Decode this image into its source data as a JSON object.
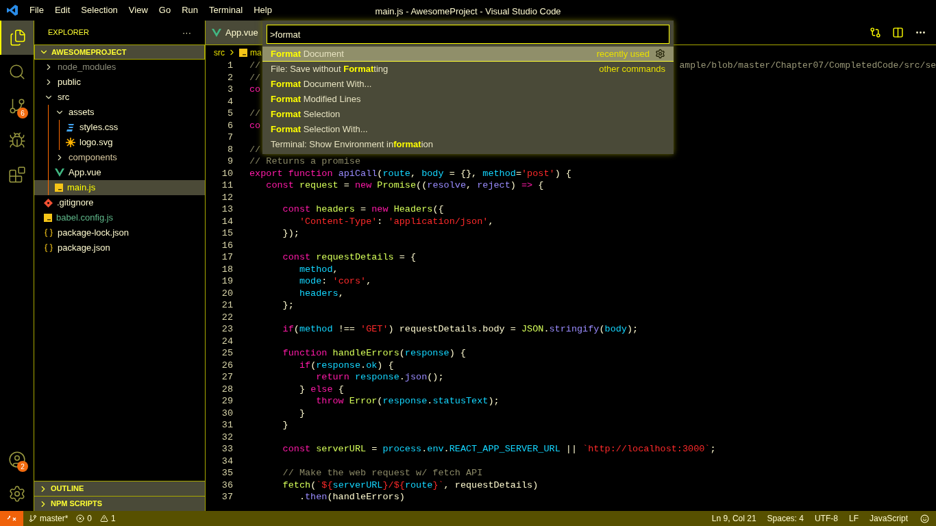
{
  "window": {
    "title": "main.js - AwesomeProject - Visual Studio Code"
  },
  "menu": [
    "File",
    "Edit",
    "Selection",
    "View",
    "Go",
    "Run",
    "Terminal",
    "Help"
  ],
  "activity_bar": [
    {
      "kind": "files",
      "selected": true
    },
    {
      "kind": "search",
      "selected": false
    },
    {
      "kind": "source-control",
      "selected": false,
      "badge": "6"
    },
    {
      "kind": "debug",
      "selected": false
    },
    {
      "kind": "extensions",
      "selected": false
    }
  ],
  "activity_bar_bottom": [
    {
      "kind": "account",
      "badge": "2"
    },
    {
      "kind": "settings"
    }
  ],
  "sidebar": {
    "title": "EXPLORER",
    "more": "···",
    "root": {
      "label": "AWESOMEPROJECT",
      "expanded": true,
      "children": [
        {
          "label": "node_modules",
          "kind": "folder",
          "expanded": false,
          "selected": false,
          "color": "#8c8c7a"
        },
        {
          "label": "public",
          "kind": "folder",
          "expanded": false,
          "selected": false,
          "color": "#fffbd0"
        },
        {
          "label": "src",
          "kind": "folder",
          "expanded": true,
          "selected": false,
          "color": "#fffbd0",
          "children": [
            {
              "label": "assets",
              "kind": "folder",
              "expanded": true,
              "selected": false,
              "color": "#fffbd0",
              "children": [
                {
                  "label": "styles.css",
                  "kind": "css",
                  "selected": false,
                  "color": "#fffbd0"
                },
                {
                  "label": "logo.svg",
                  "kind": "svg",
                  "selected": false,
                  "color": "#fffbd0"
                }
              ]
            },
            {
              "label": "components",
              "kind": "folder",
              "expanded": false,
              "selected": false,
              "color": "#d9c9a0"
            },
            {
              "label": "App.vue",
              "kind": "vue",
              "selected": false,
              "color": "#fffbd0"
            },
            {
              "label": "main.js",
              "kind": "js",
              "selected": true
            }
          ]
        },
        {
          "label": ".gitignore",
          "kind": "git",
          "selected": false,
          "color": "#fffbd0"
        },
        {
          "label": "babel.config.js",
          "kind": "js",
          "selected": false,
          "color": "#5fb88a"
        },
        {
          "label": "package-lock.json",
          "kind": "json",
          "selected": false,
          "color": "#fffbd0"
        },
        {
          "label": "package.json",
          "kind": "json",
          "selected": false,
          "color": "#fffbd0"
        }
      ]
    },
    "sections": [
      {
        "label": "OUTLINE",
        "expanded": false
      },
      {
        "label": "NPM SCRIPTS",
        "expanded": false
      }
    ]
  },
  "tabs": [
    {
      "label": "App.vue",
      "kind": "vue",
      "selected": false
    }
  ],
  "breadcrumb": [
    {
      "label": "src",
      "kind": "folder"
    },
    {
      "label": "ma",
      "kind": "js"
    }
  ],
  "command_palette": {
    "value": ">format",
    "items": [
      {
        "label": "**Format** Document",
        "detail": "recently used",
        "selected": true
      },
      {
        "label": "File: Save without **Format**ting",
        "detail": "other commands",
        "selected": false
      },
      {
        "label": "**Format** Document With...",
        "selected": false
      },
      {
        "label": "**Format** Modified Lines",
        "selected": false
      },
      {
        "label": "**Format** Selection",
        "selected": false
      },
      {
        "label": "**Format** Selection With...",
        "selected": false
      },
      {
        "label": "Terminal: Show Environment in**format**ion",
        "selected": false
      }
    ]
  },
  "editor": {
    "lines": [
      {
        "number": "1",
        "tokens": [
          {
            "text": "//",
            "kind": "cmt"
          }
        ],
        "tail": "ample/blob/master/Chapter07/CompletedCode/src/se"
      },
      {
        "number": "2",
        "tokens": [
          {
            "text": "//",
            "kind": "cmt"
          }
        ]
      },
      {
        "number": "3",
        "tokens": [
          {
            "text": "co",
            "kind": "kw"
          }
        ]
      },
      {
        "number": "4"
      },
      {
        "number": "5",
        "tokens": [
          {
            "text": "//",
            "kind": "cmt"
          }
        ]
      },
      {
        "number": "6",
        "tokens": [
          {
            "text": "co",
            "kind": "kw"
          }
        ]
      },
      {
        "number": "7"
      },
      {
        "number": "8",
        "tokens": [
          {
            "text": "//",
            "kind": "cmt"
          }
        ]
      },
      {
        "number": "9",
        "tokens": [
          {
            "text": "// Returns a promise",
            "kind": "cmt"
          }
        ]
      },
      {
        "number": "10",
        "tokens": [
          {
            "text": "export function ",
            "kind": "kw"
          },
          {
            "text": "apiCall",
            "kind": "fn"
          },
          {
            "text": "(",
            "kind": "p"
          },
          {
            "text": "route",
            "kind": "var"
          },
          {
            "text": ", ",
            "kind": "p"
          },
          {
            "text": "body",
            "kind": "var"
          },
          {
            "text": " = {}, ",
            "kind": "p"
          },
          {
            "text": "method",
            "kind": "var"
          },
          {
            "text": "=",
            "kind": "p"
          },
          {
            "text": "'post'",
            "kind": "str"
          },
          {
            "text": ") {",
            "kind": "p"
          }
        ]
      },
      {
        "number": "11",
        "tokens": [
          {
            "text": "   const ",
            "kind": "kw"
          },
          {
            "text": "request",
            "kind": "cls"
          },
          {
            "text": " = ",
            "kind": "p"
          },
          {
            "text": "new ",
            "kind": "kw"
          },
          {
            "text": "Promise",
            "kind": "cls"
          },
          {
            "text": "((",
            "kind": "p"
          },
          {
            "text": "resolve",
            "kind": "fn"
          },
          {
            "text": ", ",
            "kind": "p"
          },
          {
            "text": "reject",
            "kind": "fn"
          },
          {
            "text": ") ",
            "kind": "p"
          },
          {
            "text": "=>",
            "kind": "kw"
          },
          {
            "text": " {",
            "kind": "p"
          }
        ]
      },
      {
        "number": "12"
      },
      {
        "number": "13",
        "tokens": [
          {
            "text": "      const ",
            "kind": "kw"
          },
          {
            "text": "headers",
            "kind": "cls"
          },
          {
            "text": " = ",
            "kind": "p"
          },
          {
            "text": "new ",
            "kind": "kw"
          },
          {
            "text": "Headers",
            "kind": "cls"
          },
          {
            "text": "({",
            "kind": "p"
          }
        ]
      },
      {
        "number": "14",
        "tokens": [
          {
            "text": "         'Content-Type'",
            "kind": "str"
          },
          {
            "text": ": ",
            "kind": "p"
          },
          {
            "text": "'application/json'",
            "kind": "str"
          },
          {
            "text": ",",
            "kind": "p"
          }
        ]
      },
      {
        "number": "15",
        "tokens": [
          {
            "text": "      });",
            "kind": "p"
          }
        ]
      },
      {
        "number": "16"
      },
      {
        "number": "17",
        "tokens": [
          {
            "text": "      const ",
            "kind": "kw"
          },
          {
            "text": "requestDetails",
            "kind": "cls"
          },
          {
            "text": " = {",
            "kind": "p"
          }
        ]
      },
      {
        "number": "18",
        "tokens": [
          {
            "text": "         method",
            "kind": "var"
          },
          {
            "text": ",",
            "kind": "p"
          }
        ]
      },
      {
        "number": "19",
        "tokens": [
          {
            "text": "         mode",
            "kind": "var"
          },
          {
            "text": ": ",
            "kind": "p"
          },
          {
            "text": "'cors'",
            "kind": "str"
          },
          {
            "text": ",",
            "kind": "p"
          }
        ]
      },
      {
        "number": "20",
        "tokens": [
          {
            "text": "         headers",
            "kind": "var"
          },
          {
            "text": ",",
            "kind": "p"
          }
        ]
      },
      {
        "number": "21",
        "tokens": [
          {
            "text": "      };",
            "kind": "p"
          }
        ]
      },
      {
        "number": "22"
      },
      {
        "number": "23",
        "tokens": [
          {
            "text": "      if",
            "kind": "kw"
          },
          {
            "text": "(",
            "kind": "p"
          },
          {
            "text": "method",
            "kind": "var"
          },
          {
            "text": " !== ",
            "kind": "p"
          },
          {
            "text": "'GET'",
            "kind": "str"
          },
          {
            "text": ") requestDetails.body = ",
            "kind": "p"
          },
          {
            "text": "JSON",
            "kind": "cls"
          },
          {
            "text": ".",
            "kind": "p"
          },
          {
            "text": "stringify",
            "kind": "fn"
          },
          {
            "text": "(",
            "kind": "p"
          },
          {
            "text": "body",
            "kind": "var"
          },
          {
            "text": ");",
            "kind": "p"
          }
        ]
      },
      {
        "number": "24"
      },
      {
        "number": "25",
        "tokens": [
          {
            "text": "      function ",
            "kind": "kw"
          },
          {
            "text": "handleErrors",
            "kind": "cls"
          },
          {
            "text": "(",
            "kind": "p"
          },
          {
            "text": "response",
            "kind": "var"
          },
          {
            "text": ") {",
            "kind": "p"
          }
        ]
      },
      {
        "number": "26",
        "tokens": [
          {
            "text": "         if",
            "kind": "kw"
          },
          {
            "text": "(",
            "kind": "p"
          },
          {
            "text": "response",
            "kind": "var"
          },
          {
            "text": ".",
            "kind": "p"
          },
          {
            "text": "ok",
            "kind": "var"
          },
          {
            "text": ") {",
            "kind": "p"
          }
        ]
      },
      {
        "number": "27",
        "tokens": [
          {
            "text": "            return ",
            "kind": "kw"
          },
          {
            "text": "response",
            "kind": "var"
          },
          {
            "text": ".",
            "kind": "p"
          },
          {
            "text": "json",
            "kind": "fn"
          },
          {
            "text": "();",
            "kind": "p"
          }
        ]
      },
      {
        "number": "28",
        "tokens": [
          {
            "text": "         } ",
            "kind": "p"
          },
          {
            "text": "else",
            "kind": "kw"
          },
          {
            "text": " {",
            "kind": "p"
          }
        ]
      },
      {
        "number": "29",
        "tokens": [
          {
            "text": "            throw ",
            "kind": "kw"
          },
          {
            "text": "Error",
            "kind": "cls"
          },
          {
            "text": "(",
            "kind": "p"
          },
          {
            "text": "response",
            "kind": "var"
          },
          {
            "text": ".",
            "kind": "p"
          },
          {
            "text": "statusText",
            "kind": "var"
          },
          {
            "text": ");",
            "kind": "p"
          }
        ]
      },
      {
        "number": "30",
        "tokens": [
          {
            "text": "         }",
            "kind": "p"
          }
        ]
      },
      {
        "number": "31",
        "tokens": [
          {
            "text": "      }",
            "kind": "p"
          }
        ]
      },
      {
        "number": "32"
      },
      {
        "number": "33",
        "tokens": [
          {
            "text": "      const ",
            "kind": "kw"
          },
          {
            "text": "serverURL",
            "kind": "cls"
          },
          {
            "text": " = ",
            "kind": "p"
          },
          {
            "text": "process",
            "kind": "var"
          },
          {
            "text": ".",
            "kind": "p"
          },
          {
            "text": "env",
            "kind": "var"
          },
          {
            "text": ".",
            "kind": "p"
          },
          {
            "text": "REACT_APP_SERVER_URL",
            "kind": "var"
          },
          {
            "text": " || ",
            "kind": "p"
          },
          {
            "text": "`http://localhost:3000`",
            "kind": "str"
          },
          {
            "text": ";",
            "kind": "p"
          }
        ]
      },
      {
        "number": "34"
      },
      {
        "number": "35",
        "tokens": [
          {
            "text": "      // Make the web request w/ fetch API",
            "kind": "cmt"
          }
        ]
      },
      {
        "number": "36",
        "tokens": [
          {
            "text": "      fetch",
            "kind": "cls"
          },
          {
            "text": "(",
            "kind": "p"
          },
          {
            "text": "`${",
            "kind": "str"
          },
          {
            "text": "serverURL",
            "kind": "var"
          },
          {
            "text": "}/${",
            "kind": "str"
          },
          {
            "text": "route",
            "kind": "var"
          },
          {
            "text": "}`",
            "kind": "str"
          },
          {
            "text": ", requestDetails)",
            "kind": "p"
          }
        ]
      },
      {
        "number": "37",
        "tokens": [
          {
            "text": "         .",
            "kind": "p"
          },
          {
            "text": "then",
            "kind": "fn"
          },
          {
            "text": "(handleErrors)",
            "kind": "p"
          }
        ]
      }
    ]
  },
  "status_bar": {
    "branch": "master*",
    "errors": "0",
    "warnings": "1",
    "right": [
      "Ln 9, Col 21",
      "Spaces: 4",
      "UTF-8",
      "LF",
      "JavaScript"
    ]
  }
}
